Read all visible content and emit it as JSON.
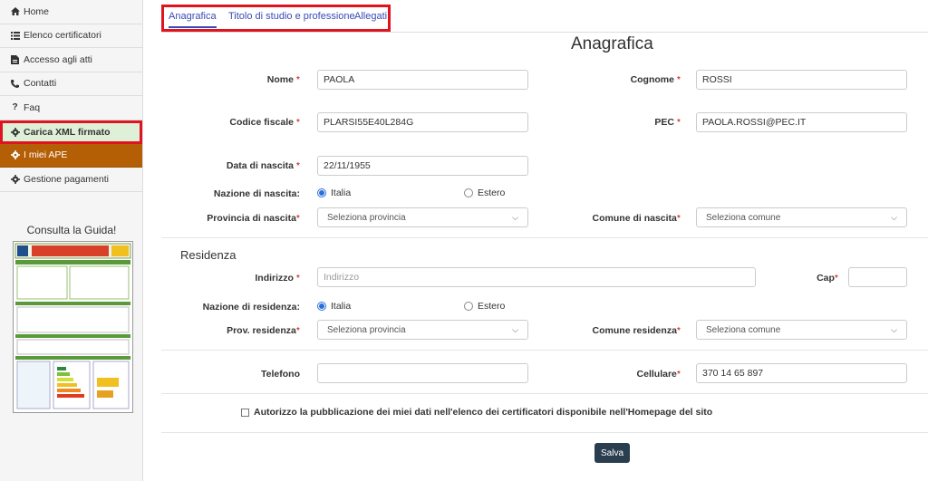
{
  "sidebar": {
    "items": [
      {
        "label": "Home",
        "icon": "home-icon"
      },
      {
        "label": "Elenco certificatori",
        "icon": "list-icon"
      },
      {
        "label": "Accesso agli atti",
        "icon": "file-icon"
      },
      {
        "label": "Contatti",
        "icon": "phone-icon"
      },
      {
        "label": "Faq",
        "icon": "question-icon"
      },
      {
        "label": "Carica XML firmato",
        "icon": "gear-icon"
      },
      {
        "label": "I miei APE",
        "icon": "gear-icon"
      },
      {
        "label": "Gestione pagamenti",
        "icon": "gear-icon"
      }
    ],
    "guide_title": "Consulta la Guida!"
  },
  "tabs": [
    "Anagrafica",
    "Titolo di studio e professione",
    "Allegati"
  ],
  "section_title": "Anagrafica",
  "form": {
    "nome_label": "Nome",
    "nome_value": "PAOLA",
    "cognome_label": "Cognome",
    "cognome_value": "ROSSI",
    "cf_label": "Codice fiscale",
    "cf_value": "PLARSI55E40L284G",
    "pec_label": "PEC",
    "pec_value": "PAOLA.ROSSI@PEC.IT",
    "nascita_label": "Data di nascita",
    "nascita_value": "22/11/1955",
    "nazione_nascita_label": "Nazione di nascita:",
    "opt_italia": "Italia",
    "opt_estero": "Estero",
    "prov_nascita_label": "Provincia di nascita",
    "prov_placeholder": "Seleziona provincia",
    "comune_nascita_label": "Comune di nascita",
    "comune_placeholder": "Seleziona comune",
    "residenza_title": "Residenza",
    "indirizzo_label": "Indirizzo",
    "indirizzo_placeholder": "Indirizzo",
    "cap_label": "Cap",
    "nazione_res_label": "Nazione di residenza:",
    "prov_res_label": "Prov. residenza",
    "comune_res_label": "Comune residenza",
    "telefono_label": "Telefono",
    "cellulare_label": "Cellulare",
    "cellulare_value": "370 14 65 897",
    "consent_text": "Autorizzo la pubblicazione dei miei dati nell'elenco dei certificatori disponibile nell'Homepage del sito",
    "save_label": "Salva",
    "required_mark": "*"
  }
}
